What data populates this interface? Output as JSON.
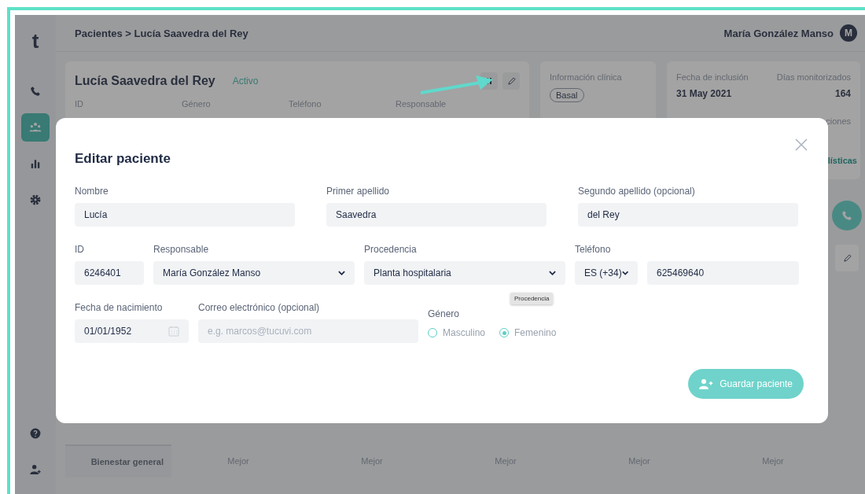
{
  "sidebar": {
    "logo": "t",
    "items": [
      {
        "kind": "phone",
        "selected": false
      },
      {
        "kind": "people",
        "selected": true
      },
      {
        "kind": "chart",
        "selected": false
      },
      {
        "kind": "gear",
        "selected": false
      }
    ],
    "bottom_items": [
      {
        "kind": "help"
      },
      {
        "kind": "add-user"
      }
    ]
  },
  "header": {
    "breadcrumb": "Pacientes > Lucía Saavedra del Rey",
    "user_name": "María González Manso",
    "avatar_initial": "M"
  },
  "patient_card": {
    "name": "Lucía Saavedra del Rey",
    "status": "Activo",
    "field_labels": [
      "ID",
      "Género",
      "Teléfono",
      "Responsable"
    ]
  },
  "clinical_card": {
    "title": "Información clínica",
    "tag": "Basal"
  },
  "stats_card": {
    "items": [
      {
        "label": "Fecha de inclusión",
        "value": "31 May 2021"
      },
      {
        "label": "Días monitorizados",
        "value": "164"
      }
    ],
    "partial_label": "ciones",
    "link": "lísticas"
  },
  "table": {
    "rows": [
      {
        "label": "Bienestar general",
        "cells": [
          "Mejor",
          "Mejor",
          "Mejor",
          "Mejor",
          "Mejor"
        ]
      }
    ]
  },
  "modal": {
    "title": "Editar paciente",
    "field_groups": [
      {
        "fields": [
          {
            "kind": "text",
            "label": "Nombre",
            "value": "Lucía"
          },
          {
            "kind": "text",
            "label": "Primer apellido",
            "value": "Saavedra"
          },
          {
            "kind": "text",
            "label": "Segundo apellido (opcional)",
            "value": "del Rey"
          }
        ]
      },
      {
        "fields": [
          {
            "kind": "text",
            "label": "ID",
            "value": "6246401"
          },
          {
            "kind": "select",
            "label": "Responsable",
            "value": "María González Manso"
          },
          {
            "kind": "select",
            "label": "Procedencia",
            "value": "Planta hospitalaria",
            "tooltip": "Procedencia"
          },
          {
            "kind": "phone",
            "label": "Teléfono",
            "prefix": "ES (+34)",
            "value": "625469640"
          }
        ]
      },
      {
        "fields": [
          {
            "kind": "date",
            "label": "Fecha de nacimiento",
            "value": "01/01/1952"
          },
          {
            "kind": "text",
            "label": "Correo electrónico (opcional)",
            "placeholder": "e.g. marcos@tucuvi.com"
          },
          {
            "kind": "radio",
            "label": "Género",
            "options": [
              {
                "label": "Masculino",
                "selected": false
              },
              {
                "label": "Femenino",
                "selected": true
              }
            ]
          }
        ]
      }
    ],
    "save_button": "Guardar paciente"
  }
}
